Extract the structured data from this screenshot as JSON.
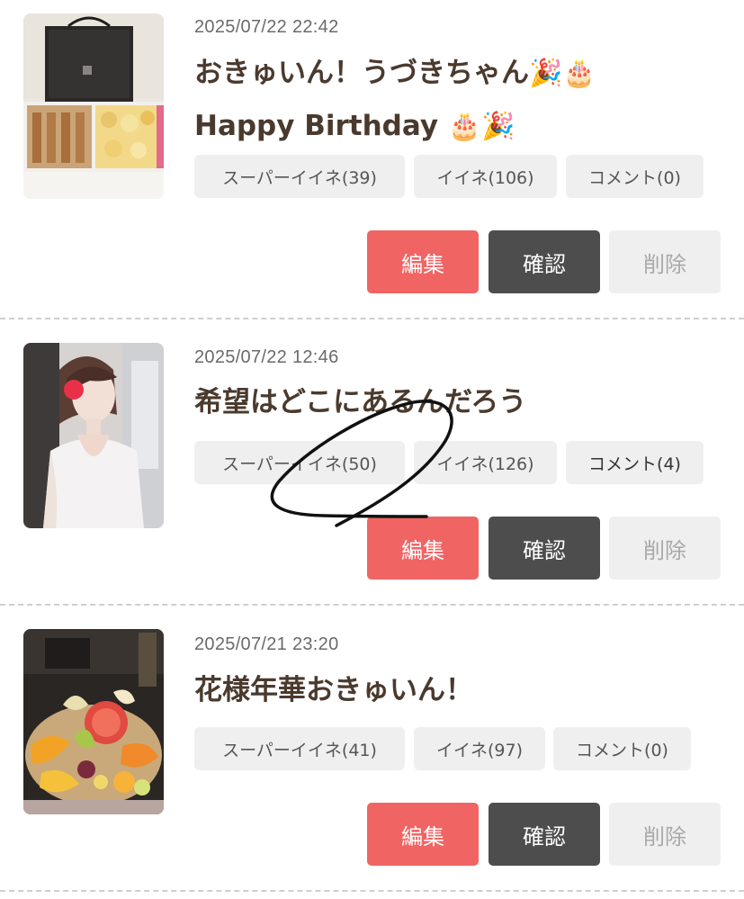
{
  "posts": [
    {
      "date": "2025/07/22 22:42",
      "title_line1": "おきゅいん！うづきちゃん",
      "title_line1_emoji": "🎉🎂",
      "title_line2": "Happy Birthday ",
      "title_line2_emoji": "🎂🎉",
      "super_like": "スーパーイイネ(39)",
      "like": "イイネ(106)",
      "comment": "コメント(0)",
      "edit": "編集",
      "confirm": "確認",
      "delete": "削除"
    },
    {
      "date": "2025/07/22 12:46",
      "title": "希望はどこにあるんだろう",
      "super_like": "スーパーイイネ(50)",
      "like": "イイネ(126)",
      "comment": "コメント(4)",
      "edit": "編集",
      "confirm": "確認",
      "delete": "削除"
    },
    {
      "date": "2025/07/21 23:20",
      "title": "花様年華おきゅいん！",
      "super_like": "スーパーイイネ(41)",
      "like": "イイネ(97)",
      "comment": "コメント(0)",
      "edit": "編集",
      "confirm": "確認",
      "delete": "削除"
    }
  ],
  "colors": {
    "edit_button": "#f06464",
    "confirm_button": "#4d4d4d",
    "delete_button": "#efefef",
    "chip": "#efefef",
    "title": "#4a3a2e"
  }
}
